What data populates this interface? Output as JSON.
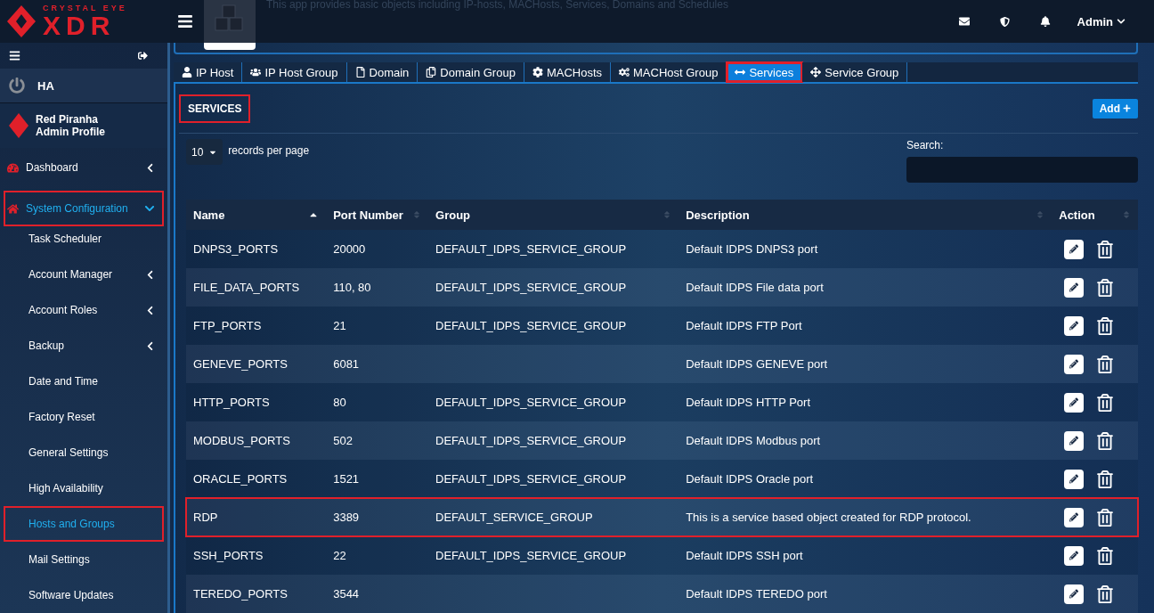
{
  "brand": {
    "tagline": "CRYSTAL EYE",
    "name": "XDR"
  },
  "header": {
    "app_description": "This app provides basic objects including IP-hosts, MACHosts, Services, Domains and Schedules",
    "user": "Admin"
  },
  "sidebar": {
    "ha_label": "HA",
    "profile": {
      "name": "Red Piranha",
      "role": "Admin Profile"
    },
    "items": [
      {
        "label": "Dashboard",
        "kind": "section",
        "expanded": false,
        "selected": false,
        "highlighted": false
      },
      {
        "label": "System Configuration",
        "kind": "section",
        "expanded": true,
        "selected": true,
        "highlighted": true
      },
      {
        "label": "Task Scheduler",
        "kind": "sub",
        "selected": false,
        "highlighted": false
      },
      {
        "label": "Account Manager",
        "kind": "sub",
        "expanded": false,
        "selected": false,
        "highlighted": false
      },
      {
        "label": "Account Roles",
        "kind": "sub",
        "expanded": false,
        "selected": false,
        "highlighted": false
      },
      {
        "label": "Backup",
        "kind": "sub",
        "expanded": false,
        "selected": false,
        "highlighted": false
      },
      {
        "label": "Date and Time",
        "kind": "sub",
        "selected": false,
        "highlighted": false
      },
      {
        "label": "Factory Reset",
        "kind": "sub",
        "selected": false,
        "highlighted": false
      },
      {
        "label": "General Settings",
        "kind": "sub",
        "selected": false,
        "highlighted": false
      },
      {
        "label": "High Availability",
        "kind": "sub",
        "selected": false,
        "highlighted": false
      },
      {
        "label": "Hosts and Groups",
        "kind": "sub",
        "selected": true,
        "highlighted": true
      },
      {
        "label": "Mail Settings",
        "kind": "sub",
        "selected": false,
        "highlighted": false
      },
      {
        "label": "Software Updates",
        "kind": "sub",
        "selected": false,
        "highlighted": false
      }
    ]
  },
  "tabs": [
    {
      "label": "IP Host",
      "selected": false,
      "highlighted": false
    },
    {
      "label": "IP Host Group",
      "selected": false,
      "highlighted": false
    },
    {
      "label": "Domain",
      "selected": false,
      "highlighted": false
    },
    {
      "label": "Domain Group",
      "selected": false,
      "highlighted": false
    },
    {
      "label": "MACHosts",
      "selected": false,
      "highlighted": false
    },
    {
      "label": "MACHost Group",
      "selected": false,
      "highlighted": false
    },
    {
      "label": "Services",
      "selected": true,
      "highlighted": true
    },
    {
      "label": "Service Group",
      "selected": false,
      "highlighted": false
    }
  ],
  "panel": {
    "title": "SERVICES",
    "highlighted": true,
    "add_button": "Add",
    "page_size": "10",
    "page_size_suffix": "records per page",
    "search_label": "Search:"
  },
  "table": {
    "columns": [
      {
        "label": "Name",
        "sorted": true
      },
      {
        "label": "Port Number",
        "sorted": false
      },
      {
        "label": "Group",
        "sorted": false
      },
      {
        "label": "Description",
        "sorted": false
      },
      {
        "label": "Action",
        "sorted": false
      }
    ],
    "rows": [
      {
        "cells": [
          "DNPS3_PORTS",
          "20000",
          "DEFAULT_IDPS_SERVICE_GROUP",
          "Default IDPS DNPS3 port"
        ],
        "highlighted": false
      },
      {
        "cells": [
          "FILE_DATA_PORTS",
          "110, 80",
          "DEFAULT_IDPS_SERVICE_GROUP",
          "Default IDPS File data port"
        ],
        "highlighted": false
      },
      {
        "cells": [
          "FTP_PORTS",
          "21",
          "DEFAULT_IDPS_SERVICE_GROUP",
          "Default IDPS FTP Port"
        ],
        "highlighted": false
      },
      {
        "cells": [
          "GENEVE_PORTS",
          "6081",
          "",
          "Default IDPS GENEVE port"
        ],
        "highlighted": false
      },
      {
        "cells": [
          "HTTP_PORTS",
          "80",
          "DEFAULT_IDPS_SERVICE_GROUP",
          "Default IDPS HTTP Port"
        ],
        "highlighted": false
      },
      {
        "cells": [
          "MODBUS_PORTS",
          "502",
          "DEFAULT_IDPS_SERVICE_GROUP",
          "Default IDPS Modbus port"
        ],
        "highlighted": false
      },
      {
        "cells": [
          "ORACLE_PORTS",
          "1521",
          "DEFAULT_IDPS_SERVICE_GROUP",
          "Default IDPS Oracle port"
        ],
        "highlighted": false
      },
      {
        "cells": [
          "RDP",
          "3389",
          "DEFAULT_SERVICE_GROUP",
          "This is a service based object created for RDP protocol."
        ],
        "highlighted": true
      },
      {
        "cells": [
          "SSH_PORTS",
          "22",
          "DEFAULT_IDPS_SERVICE_GROUP",
          "Default IDPS SSH port"
        ],
        "highlighted": false
      },
      {
        "cells": [
          "TEREDO_PORTS",
          "3544",
          "",
          "Default IDPS TEREDO port"
        ],
        "highlighted": false
      }
    ]
  }
}
